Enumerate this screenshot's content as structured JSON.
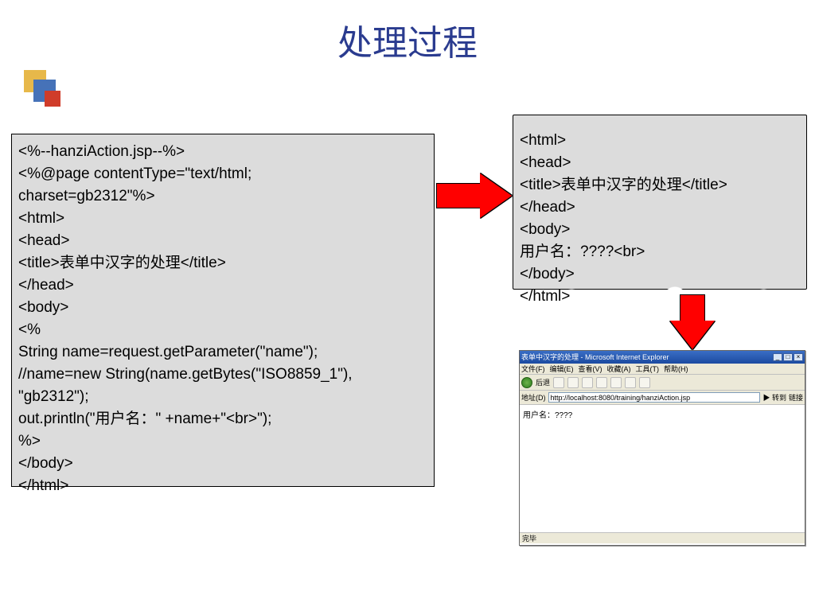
{
  "slide": {
    "title": "处理过程"
  },
  "code_left": {
    "lines": [
      "<%--hanziAction.jsp--%>",
      "<%@page contentType=\"text/html;",
      "charset=gb2312\"%>",
      "<html>",
      "<head>",
      "<title>表单中汉字的处理</title>",
      "</head>",
      "<body>",
      "<%",
      "String name=request.getParameter(\"name\");",
      "//name=new String(name.getBytes(\"ISO8859_1\"),",
      " \"gb2312\");",
      "out.println(\"用户名：\" +name+\"<br>\");",
      "%>",
      "</body>",
      "</html>"
    ]
  },
  "code_right": {
    "lines": [
      "<html>",
      "<head>",
      "<title>表单中汉字的处理</title>",
      "</head>",
      "<body>",
      "用户名：????<br>",
      "</body>",
      "</html>"
    ]
  },
  "ie": {
    "title": "表单中汉字的处理 - Microsoft Internet Explorer",
    "menu": [
      "文件(F)",
      "编辑(E)",
      "查看(V)",
      "收藏(A)",
      "工具(T)",
      "帮助(H)"
    ],
    "toolbar": {
      "back": "后退"
    },
    "addr_label": "地址(D)",
    "url": "http://localhost:8080/training/hanziAction.jsp",
    "go": "转到",
    "links": "链接",
    "content": "用户名：????",
    "status": "完毕"
  }
}
